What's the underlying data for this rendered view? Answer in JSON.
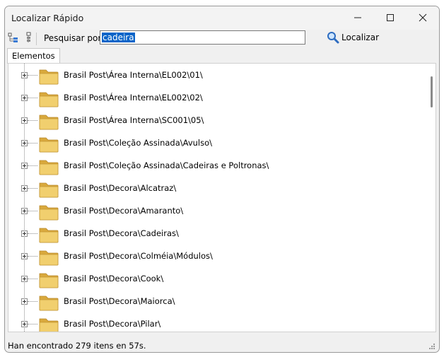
{
  "window": {
    "title": "Localizar Rápido"
  },
  "toolbar": {
    "search_label": "Pesquisar por:",
    "search_value": "cadeira",
    "find_label": "Localizar"
  },
  "tabs": [
    {
      "label": "Elementos",
      "active": true
    }
  ],
  "tree": {
    "items": [
      {
        "label": "Brasil Post\\Área Interna\\EL002\\01\\"
      },
      {
        "label": "Brasil Post\\Área Interna\\EL002\\02\\"
      },
      {
        "label": "Brasil Post\\Área Interna\\SC001\\05\\"
      },
      {
        "label": "Brasil Post\\Coleção Assinada\\Avulso\\"
      },
      {
        "label": "Brasil Post\\Coleção Assinada\\Cadeiras e Poltronas\\"
      },
      {
        "label": "Brasil Post\\Decora\\Alcatraz\\"
      },
      {
        "label": "Brasil Post\\Decora\\Amaranto\\"
      },
      {
        "label": "Brasil Post\\Decora\\Cadeiras\\"
      },
      {
        "label": "Brasil Post\\Decora\\Colméia\\Módulos\\"
      },
      {
        "label": "Brasil Post\\Decora\\Cook\\"
      },
      {
        "label": "Brasil Post\\Decora\\Maiorca\\"
      },
      {
        "label": "Brasil Post\\Decora\\Pilar\\"
      }
    ]
  },
  "status": {
    "text": "Han encontrado 279 itens en 57s."
  },
  "icons": {
    "folder": "folder-icon",
    "search": "magnifier-icon",
    "expand_all": "expand-tree-icon",
    "collapse_all": "collapse-tree-icon"
  },
  "colors": {
    "selection": "#0a64c8",
    "folder": "#e8c15a"
  }
}
